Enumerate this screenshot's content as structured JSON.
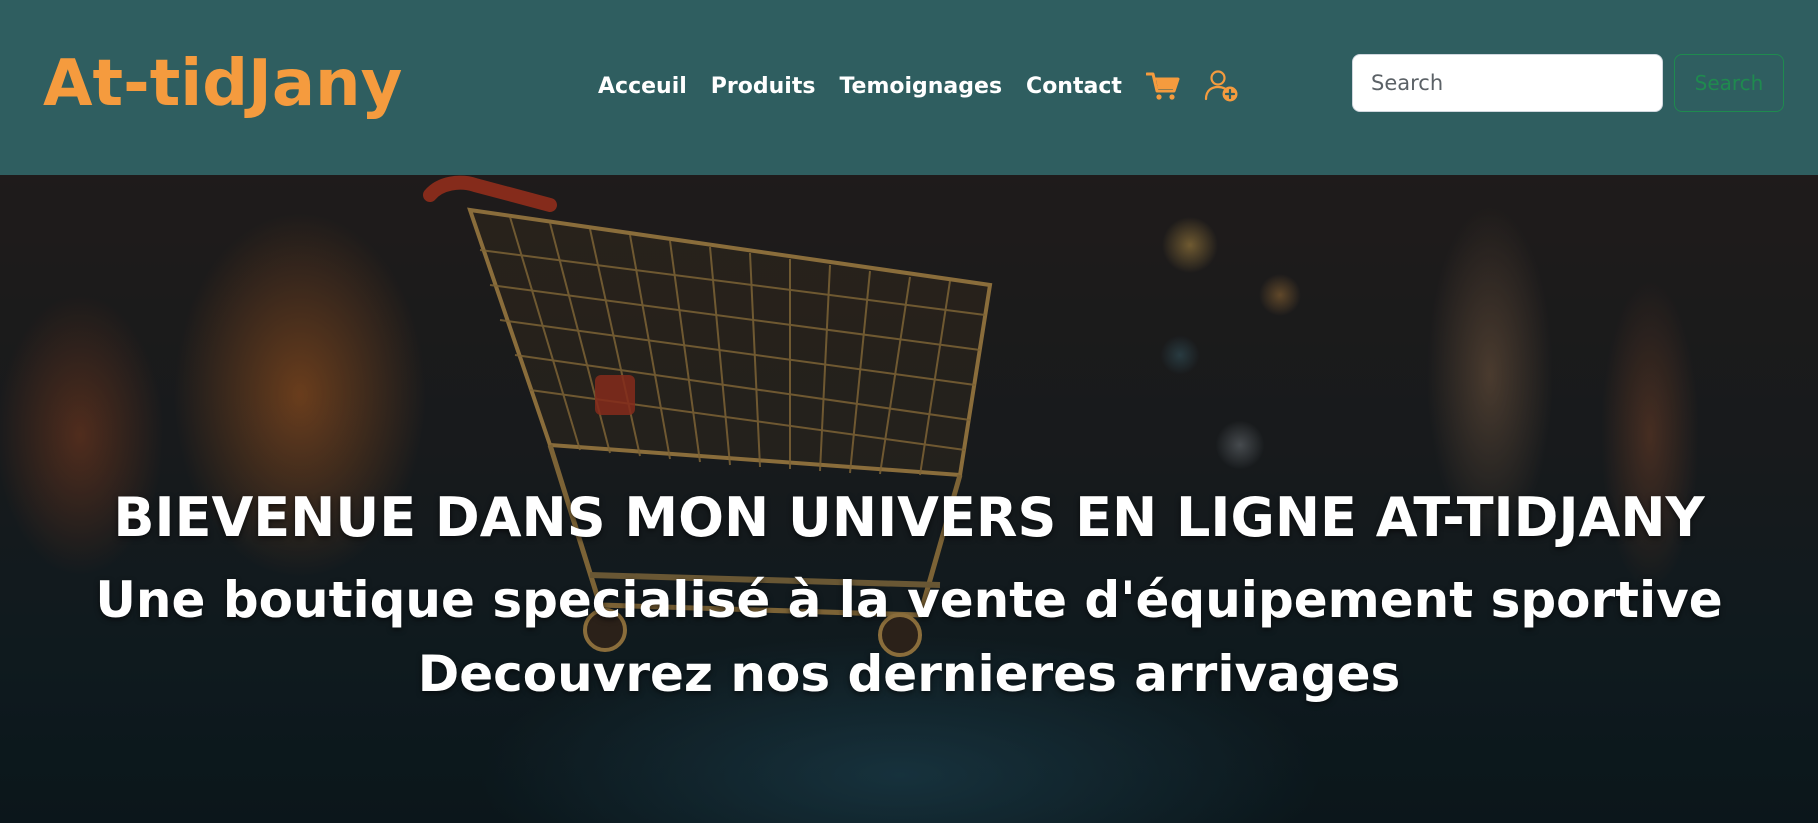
{
  "navbar": {
    "brand": "At-tidJany",
    "links": [
      {
        "label": "Acceuil"
      },
      {
        "label": "Produits"
      },
      {
        "label": "Temoignages"
      },
      {
        "label": "Contact"
      }
    ],
    "cart_icon": "shopping-cart-icon",
    "account_icon": "user-add-icon",
    "search": {
      "placeholder": "Search",
      "value": "",
      "button_label": "Search"
    }
  },
  "hero": {
    "image": "shopping-cart-on-wet-street-night-photo",
    "title": "BIEVENUE DANS MON UNIVERS EN LIGNE AT-TIDJANY",
    "subtitle_line1": "Une boutique specialisé à la vente d'équipement sportive",
    "subtitle_line2": "Decouvrez nos dernieres arrivages"
  },
  "colors": {
    "navbar_bg": "#2f5e60",
    "brand": "#f59b3e",
    "accent_icons": "#f59b3e",
    "search_button": "#1f8a4f",
    "hero_text": "#ffffff"
  }
}
